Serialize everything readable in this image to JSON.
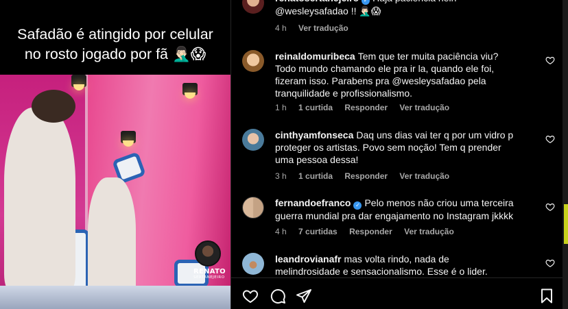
{
  "post": {
    "caption_line1": "Safadão é atingido por celular",
    "caption_line2": "no rosto jogado por fã 🤦🏻‍♂️😱",
    "watermark_name": "RENATO",
    "watermark_sub": "SERTANEJEIRO"
  },
  "comments": [
    {
      "username": "renatosertanejeiro",
      "verified": true,
      "text": "Haja paciencia hein @wesleysafadao !! 🤦🏻‍♂️😱",
      "time": "4 h",
      "likes": "",
      "reply": "",
      "translate": "Ver tradução",
      "avatar_color": "#5a1f1f"
    },
    {
      "username": "reinaldomuribeca",
      "verified": false,
      "text": "Tem que ter muita paciência viu? Todo mundo chamando ele pra ir la, quando ele foi, fizeram isso. Parabens pra @wesleysafadao pela tranquilidade e profissionalismo.",
      "time": "1 h",
      "likes": "1 curtida",
      "reply": "Responder",
      "translate": "Ver tradução",
      "avatar_color": "#c9a06a"
    },
    {
      "username": "cinthyamfonseca",
      "verified": false,
      "text": "Daq uns dias vai ter q por um vidro p proteger os artistas. Povo sem noção! Tem q prender uma pessoa dessa!",
      "time": "3 h",
      "likes": "1 curtida",
      "reply": "Responder",
      "translate": "Ver tradução",
      "avatar_color": "#4a7a9a"
    },
    {
      "username": "fernandoefranco",
      "verified": true,
      "text": "Pelo menos não criou uma terceira guerra mundial pra dar engajamento no Instagram jkkkk",
      "time": "4 h",
      "likes": "7 curtidas",
      "reply": "Responder",
      "translate": "Ver tradução",
      "avatar_color": "#6a6a6a"
    },
    {
      "username": "leandrovianafr",
      "verified": false,
      "text": "mas volta rindo, nada de melindrosidade e sensacionalismo. Esse é o lider.",
      "time": "",
      "likes": "",
      "reply": "",
      "translate": "",
      "avatar_color": "#8fb7d6"
    }
  ],
  "actions": {
    "like_icon": "heart-icon",
    "comment_icon": "comment-icon",
    "share_icon": "share-icon",
    "save_icon": "bookmark-icon"
  }
}
